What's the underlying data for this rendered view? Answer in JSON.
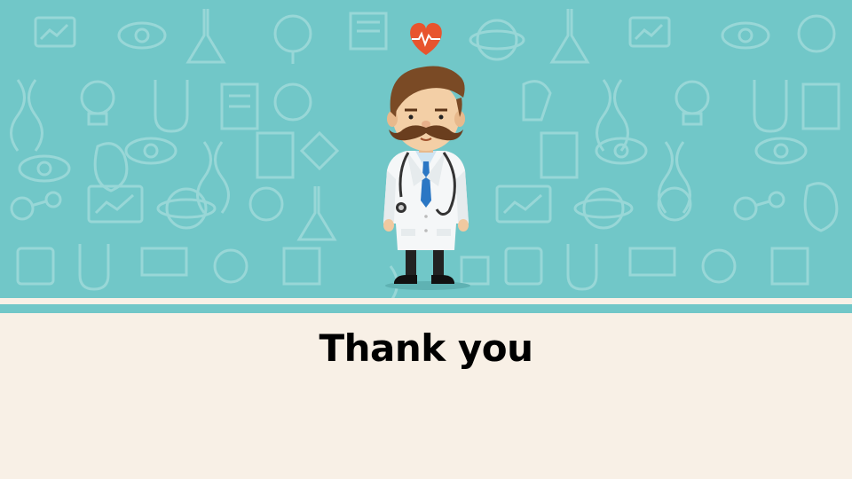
{
  "slide": {
    "title": "Thank you"
  },
  "colors": {
    "banner": "#71c7c8",
    "pattern_icon": "#9fdada",
    "background": "#f8f0e6",
    "heart": "#e8542e",
    "title_text": "#000000"
  },
  "icons": [
    "heart-pulse-icon",
    "doctor-illustration",
    "science-pattern"
  ]
}
